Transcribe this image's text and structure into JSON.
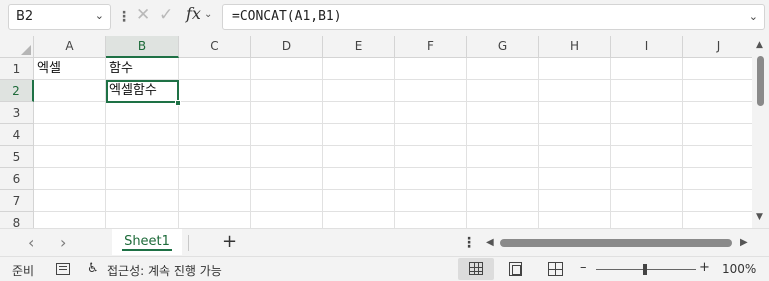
{
  "formula_bar": {
    "name_box": "B2",
    "name_box_caret": "⌄",
    "more": "⋮",
    "cancel_glyph": "✕",
    "enter_glyph": "✓",
    "fx": "fx",
    "fx_caret": "⌄",
    "formula": "=CONCAT(A1,B1)",
    "formula_caret": "⌄"
  },
  "grid": {
    "columns": [
      "A",
      "B",
      "C",
      "D",
      "E",
      "F",
      "G",
      "H",
      "I",
      "J"
    ],
    "rows": [
      "1",
      "2",
      "3",
      "4",
      "5",
      "6",
      "7",
      "8"
    ],
    "selected_column": "B",
    "selected_row": "2",
    "cells": {
      "A1": "엑셀",
      "B1": "함수",
      "B2": "엑셀함수"
    }
  },
  "sheet_tabs": {
    "prev": "‹",
    "next": "›",
    "active_sheet": "Sheet1",
    "add": "+",
    "more": "⋮",
    "scroll_left": "◀",
    "scroll_right": "▶"
  },
  "status_bar": {
    "ready": "준비",
    "accessibility_icon": "♿",
    "accessibility": "접근성: 계속 진행 가능",
    "zoom_minus": "–",
    "zoom_plus": "+",
    "zoom_level": "100%",
    "zoom_fraction": 1.0
  },
  "colors": {
    "accent": "#1e7145",
    "header_bg": "#f3f3f3",
    "grid_line": "#e1e1e1"
  },
  "icons": {
    "name_box_dropdown": "chevron-down-icon",
    "cancel": "close-icon",
    "enter": "check-icon",
    "insert_function": "fx-icon",
    "macro": "macro-recorder-icon",
    "accessibility": "accessibility-icon",
    "normal_view": "grid-view-icon",
    "page_layout": "page-layout-icon",
    "page_break": "page-break-icon"
  }
}
